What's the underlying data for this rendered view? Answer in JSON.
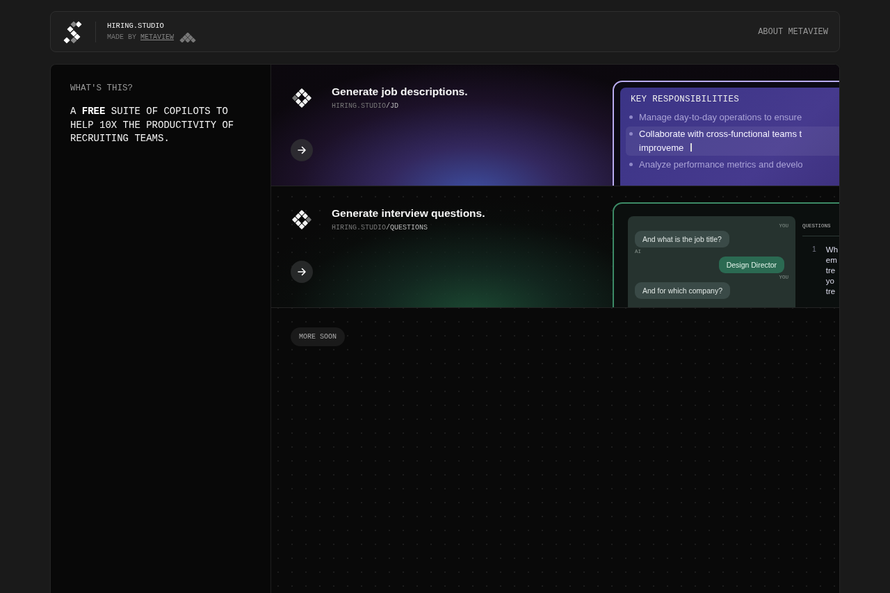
{
  "header": {
    "title": "HIRING.STUDIO",
    "made_by": "MADE BY",
    "made_by_link": "METAVIEW",
    "about_link": "ABOUT METAVIEW"
  },
  "intro": {
    "heading": "WHAT'S THIS?",
    "text": "A **FREE** SUITE OF COPILOTS TO HELP 10X THE PRODUCTIVITY OF RECRUITING TEAMS."
  },
  "tools": [
    {
      "kind": "jd",
      "title": "Generate job descriptions.",
      "url_base": "HIRING.STUDIO",
      "url_path": "/JD",
      "preview": {
        "heading": "KEY RESPONSIBILITIES",
        "bullets": [
          {
            "lines": [
              "Manage day-to-day operations to ensure"
            ],
            "selected": false
          },
          {
            "lines": [
              "Collaborate with cross-functional teams t",
              "improveme"
            ],
            "selected": true
          },
          {
            "lines": [
              "Analyze performance metrics and develo"
            ],
            "selected": false
          }
        ]
      }
    },
    {
      "kind": "questions",
      "title": "Generate interview questions.",
      "url_base": "HIRING.STUDIO",
      "url_path": "/QUESTIONS",
      "preview": {
        "messages": [
          {
            "kind": "question",
            "label": "YOU",
            "text": "And what is the job title?"
          },
          {
            "kind": "answer",
            "label": "AI",
            "text": "Design Director"
          },
          {
            "kind": "question",
            "label": "YOU",
            "text": "And for which company?"
          }
        ],
        "questions_heading": "QUESTIONS",
        "questions": [
          {
            "number": "1",
            "lines": [
              "Wh",
              "em",
              "tre",
              "yo",
              "tre"
            ]
          }
        ]
      }
    }
  ],
  "more_soon": "MORE SOON"
}
